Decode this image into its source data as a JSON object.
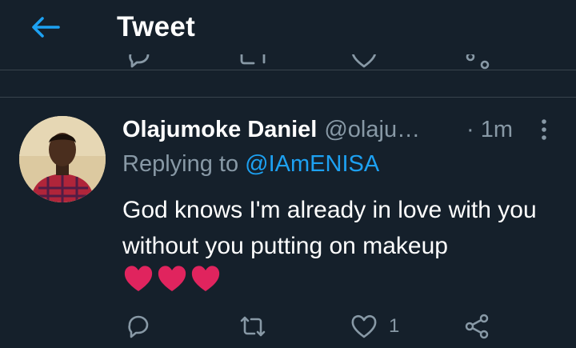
{
  "header": {
    "title": "Tweet"
  },
  "tweet": {
    "author_name": "Olajumoke Daniel",
    "author_handle": "@olaju…",
    "time": "· 1m",
    "replying_prefix": "Replying to",
    "replying_to": "@IAmENISA",
    "text": "God knows I'm already in love with you without you putting on makeup",
    "emoji": "❤️❤️❤️",
    "likes": "1"
  },
  "colors": {
    "background": "#15202b",
    "accent": "#1da1f2",
    "secondary_text": "#8899a6",
    "divider": "#38444d",
    "heart": "#e0245e"
  },
  "icons": [
    "back-arrow-icon",
    "more-vertical-icon",
    "reply-icon",
    "retweet-icon",
    "like-icon",
    "share-icon",
    "heart-emoji"
  ]
}
